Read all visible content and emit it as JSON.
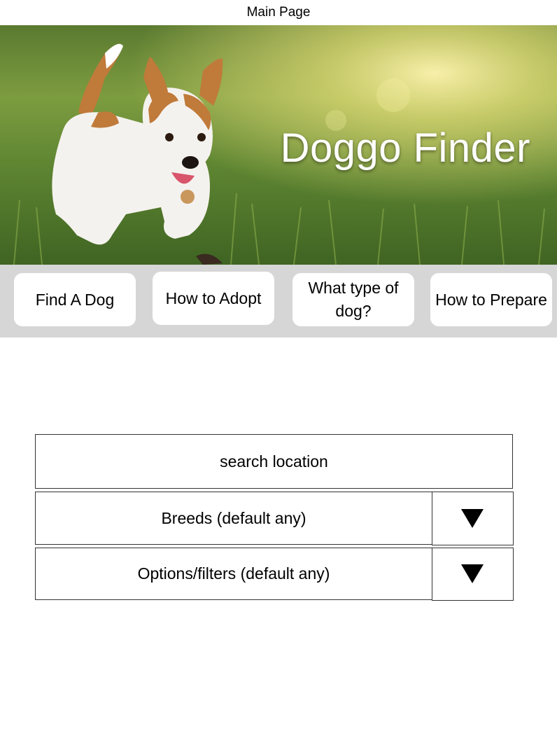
{
  "page": {
    "title": "Main Page"
  },
  "hero": {
    "title": "Doggo Finder",
    "image": "dog-running-in-grass"
  },
  "nav": {
    "items": [
      {
        "label": "Find A Dog"
      },
      {
        "label": "How to Adopt"
      },
      {
        "label": "What type of dog?"
      },
      {
        "label": "How to Prepare"
      }
    ]
  },
  "search": {
    "location_label": "search location",
    "breeds_label": "Breeds (default any)",
    "options_label": "Options/filters (default any)",
    "dropdown_icon": "triangle-down"
  },
  "colors": {
    "nav_background": "#d6d6d6",
    "button_background": "#ffffff",
    "hero_text": "#ffffff"
  }
}
